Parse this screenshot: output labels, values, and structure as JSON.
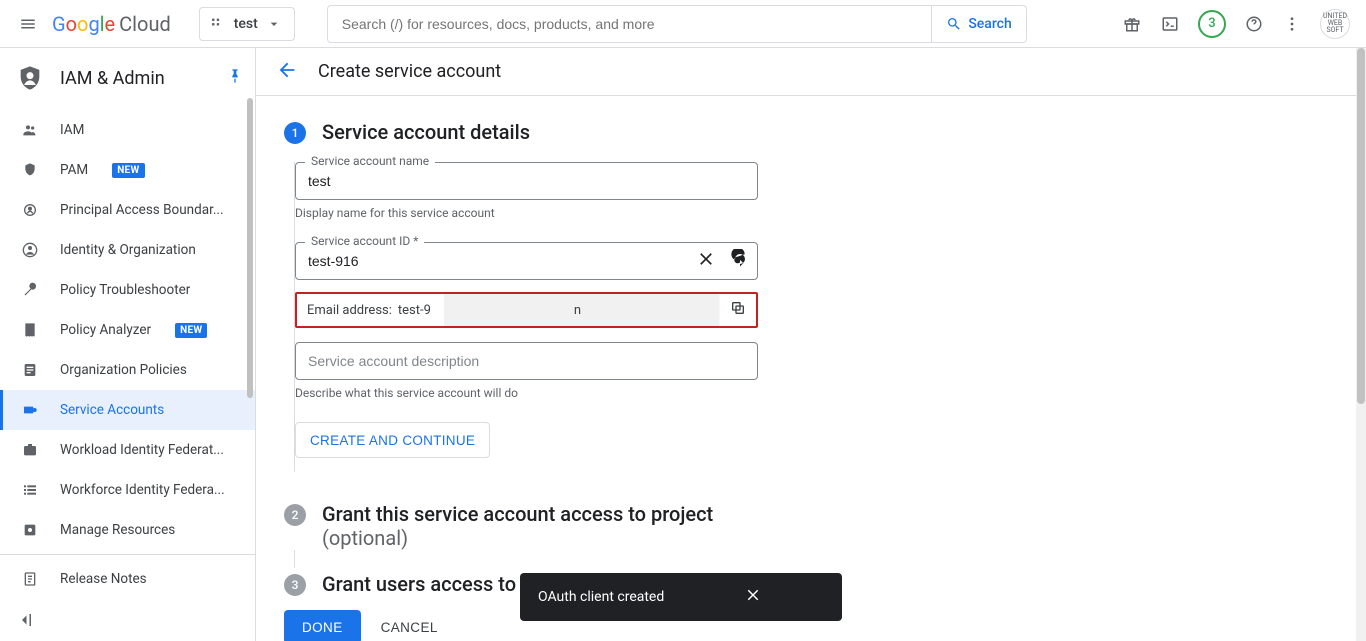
{
  "topbar": {
    "project": "test",
    "search_placeholder": "Search (/) for resources, docs, products, and more",
    "search_button": "Search",
    "trial_count": "3",
    "avatar_text": "UNITED WEB SOFT"
  },
  "sidebar": {
    "title": "IAM & Admin",
    "items": [
      {
        "label": "IAM"
      },
      {
        "label": "PAM",
        "badge": "NEW"
      },
      {
        "label": "Principal Access Boundar..."
      },
      {
        "label": "Identity & Organization"
      },
      {
        "label": "Policy Troubleshooter"
      },
      {
        "label": "Policy Analyzer",
        "badge": "NEW"
      },
      {
        "label": "Organization Policies"
      },
      {
        "label": "Service Accounts"
      },
      {
        "label": "Workload Identity Federat..."
      },
      {
        "label": "Workforce Identity Federa..."
      },
      {
        "label": "Manage Resources"
      },
      {
        "label": "Release Notes"
      }
    ]
  },
  "page": {
    "title": "Create service account",
    "step1": {
      "num": "1",
      "title": "Service account details",
      "name_label": "Service account name",
      "name_value": "test",
      "name_helper": "Display name for this service account",
      "id_label": "Service account ID *",
      "id_value": "test-916",
      "email_prefix": "Email address: ",
      "email_value": "test-9",
      "email_suffix": "n",
      "desc_placeholder": "Service account description",
      "desc_helper": "Describe what this service account will do",
      "create_continue": "CREATE AND CONTINUE"
    },
    "step2": {
      "num": "2",
      "title": "Grant this service account access to project",
      "optional": "(optional)"
    },
    "step3": {
      "num": "3",
      "title": "Grant users access to"
    },
    "done": "DONE",
    "cancel": "CANCEL"
  },
  "toast": {
    "message": "OAuth client created"
  }
}
